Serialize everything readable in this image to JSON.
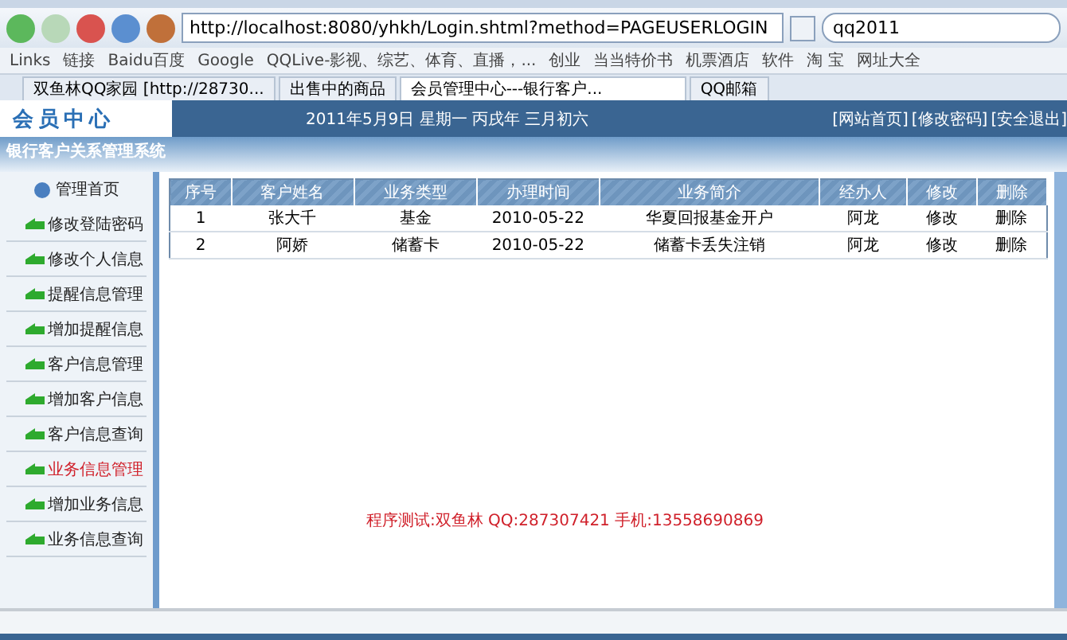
{
  "browser": {
    "address": "http://localhost:8080/yhkh/Login.shtml?method=PAGEUSERLOGIN",
    "search": "qq2011",
    "links": [
      {
        "label": "Links"
      },
      {
        "label": "链接"
      },
      {
        "label": "Baidu百度"
      },
      {
        "label": "Google"
      },
      {
        "label": "QQLive-影视、综艺、体育、直播，..."
      },
      {
        "label": "创业"
      },
      {
        "label": "当当特价书"
      },
      {
        "label": "机票酒店"
      },
      {
        "label": "软件"
      },
      {
        "label": "淘 宝"
      },
      {
        "label": "网址大全"
      }
    ],
    "tabs": [
      {
        "label": "双鱼林QQ家园 [http://28730...",
        "selected": false
      },
      {
        "label": "出售中的商品",
        "selected": false
      },
      {
        "label": "会员管理中心---银行客户...",
        "selected": true
      },
      {
        "label": "QQ邮箱",
        "selected": false
      }
    ]
  },
  "header": {
    "logo": "会员中心",
    "date": "2011年5月9日  星期一  丙戌年  三月初六",
    "links": [
      "[网站首页]",
      "[修改密码]",
      "[安全退出]"
    ]
  },
  "system_title": "银行客户关系管理系统",
  "sidebar": {
    "title": "管理首页",
    "items": [
      {
        "label": "修改登陆密码",
        "selected": false
      },
      {
        "label": "修改个人信息",
        "selected": false
      },
      {
        "label": "提醒信息管理",
        "selected": false
      },
      {
        "label": "增加提醒信息",
        "selected": false
      },
      {
        "label": "客户信息管理",
        "selected": false
      },
      {
        "label": "增加客户信息",
        "selected": false
      },
      {
        "label": "客户信息查询",
        "selected": false
      },
      {
        "label": "业务信息管理",
        "selected": true
      },
      {
        "label": "增加业务信息",
        "selected": false
      },
      {
        "label": "业务信息查询",
        "selected": false
      }
    ]
  },
  "table": {
    "columns": [
      "序号",
      "客户姓名",
      "业务类型",
      "办理时间",
      "业务简介",
      "经办人",
      "修改",
      "删除"
    ],
    "rows": [
      [
        "1",
        "张大千",
        "基金",
        "2010-05-22",
        "华夏回报基金开户",
        "阿龙",
        "修改",
        "删除"
      ],
      [
        "2",
        "阿娇",
        "储蓄卡",
        "2010-05-22",
        "储蓄卡丢失注销",
        "阿龙",
        "修改",
        "删除"
      ]
    ]
  },
  "footer_note": "程序测试:双鱼林 QQ:287307421 手机:13558690869"
}
